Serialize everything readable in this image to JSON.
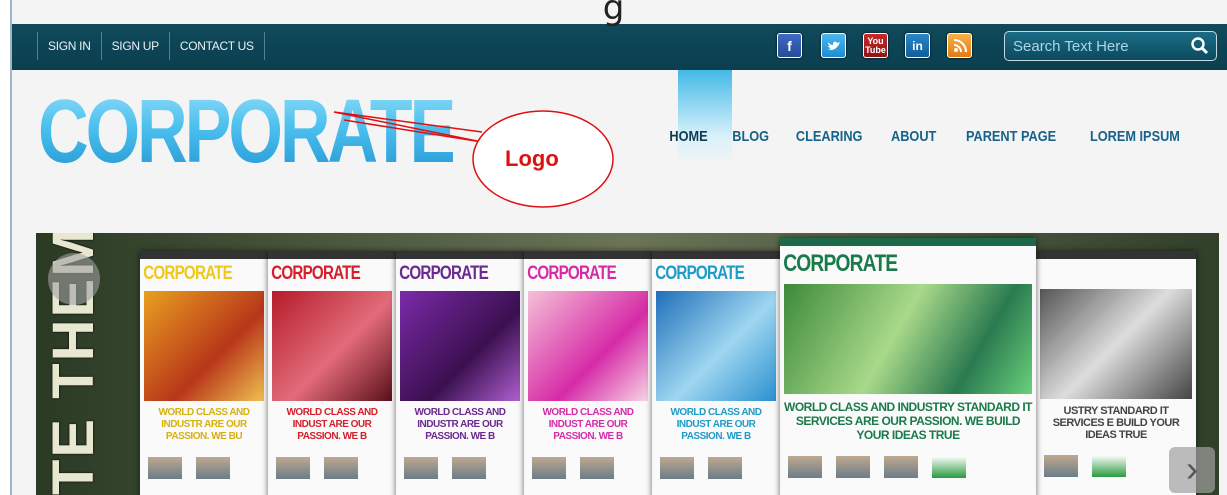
{
  "page": {
    "cut_heading": "g"
  },
  "topbar": {
    "links": [
      "SIGN IN",
      "SIGN UP",
      "CONTACT US"
    ],
    "social": [
      {
        "icon": "facebook-icon",
        "glyph": "f"
      },
      {
        "icon": "twitter-icon",
        "glyph": "t"
      },
      {
        "icon": "youtube-icon",
        "glyph": "You Tube"
      },
      {
        "icon": "linkedin-icon",
        "glyph": "in"
      },
      {
        "icon": "rss-icon",
        "glyph": "))"
      }
    ],
    "search_placeholder": "Search Text Here"
  },
  "header": {
    "logo": "CORPORATE",
    "callout": "Logo",
    "nav": [
      "HOME",
      "BLOG",
      "CLEARING",
      "ABOUT",
      "PARENT PAGE",
      "LOREM IPSUM"
    ],
    "active_nav": "HOME"
  },
  "slider": {
    "vertical_text": "TE THEME",
    "cards": [
      {
        "title": "CORPORATE",
        "color": "#f0c81a",
        "tagline": "WORLD CLASS AND INDUSTR ARE OUR PASSION. WE BU"
      },
      {
        "title": "CORPORATE",
        "color": "#d41f2c",
        "tagline": "WORLD CLASS AND INDUST ARE OUR PASSION. WE B"
      },
      {
        "title": "CORPORATE",
        "color": "#6a2a90",
        "tagline": "WORLD CLASS AND INDUSTR ARE OUR PASSION. WE B"
      },
      {
        "title": "CORPORATE",
        "color": "#d62ba6",
        "tagline": "WORLD CLASS AND INDUST ARE OUR PASSION. WE B"
      },
      {
        "title": "CORPORATE",
        "color": "#1d9bc9",
        "tagline": "WORLD CLASS AND INDUST ARE OUR PASSION. WE B"
      }
    ],
    "featured": {
      "title": "CORPORATE",
      "color": "#1b7a4a",
      "tagline": "WORLD CLASS AND INDUSTRY STANDARD IT SERVICES ARE OUR PASSION. WE BUILD YOUR IDEAS TRUE"
    },
    "last_card": {
      "tagline": "USTRY STANDARD IT SERVICES E BUILD YOUR IDEAS TRUE"
    },
    "next_arrow": "›"
  }
}
